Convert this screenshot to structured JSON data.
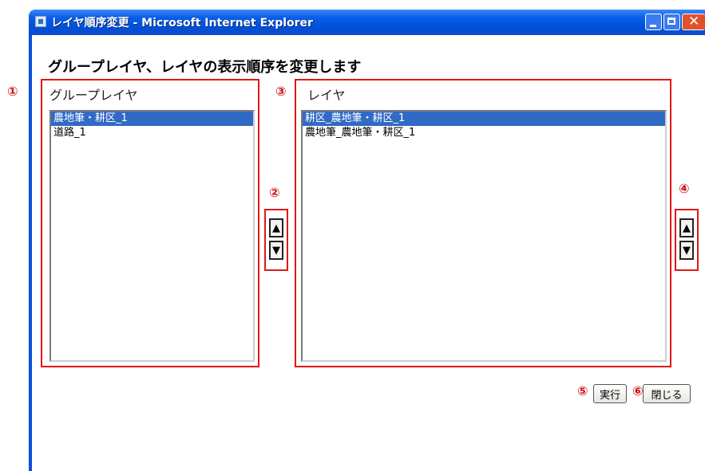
{
  "window": {
    "title": "レイヤ順序変更 - Microsoft Internet Explorer",
    "close_glyph": "✕"
  },
  "heading": "グループレイヤ、レイヤの表示順序を変更します",
  "group_panel": {
    "label": "グループレイヤ",
    "items": [
      {
        "label": "農地筆・耕区_1",
        "selected": true
      },
      {
        "label": "道路_1",
        "selected": false
      }
    ]
  },
  "layer_panel": {
    "label": "レイヤ",
    "items": [
      {
        "label": "耕区_農地筆・耕区_1",
        "selected": true
      },
      {
        "label": "農地筆_農地筆・耕区_1",
        "selected": false
      }
    ]
  },
  "order_buttons": {
    "up": "▲",
    "down": "▼"
  },
  "markers": {
    "m1": "①",
    "m2": "②",
    "m3": "③",
    "m4": "④",
    "m5": "⑤",
    "m6": "⑥"
  },
  "buttons": {
    "execute": "実行",
    "close": "閉じる"
  },
  "colors": {
    "annotation": "#e01818",
    "selection": "#316ac5",
    "titlebar": "#0a5ee8"
  }
}
